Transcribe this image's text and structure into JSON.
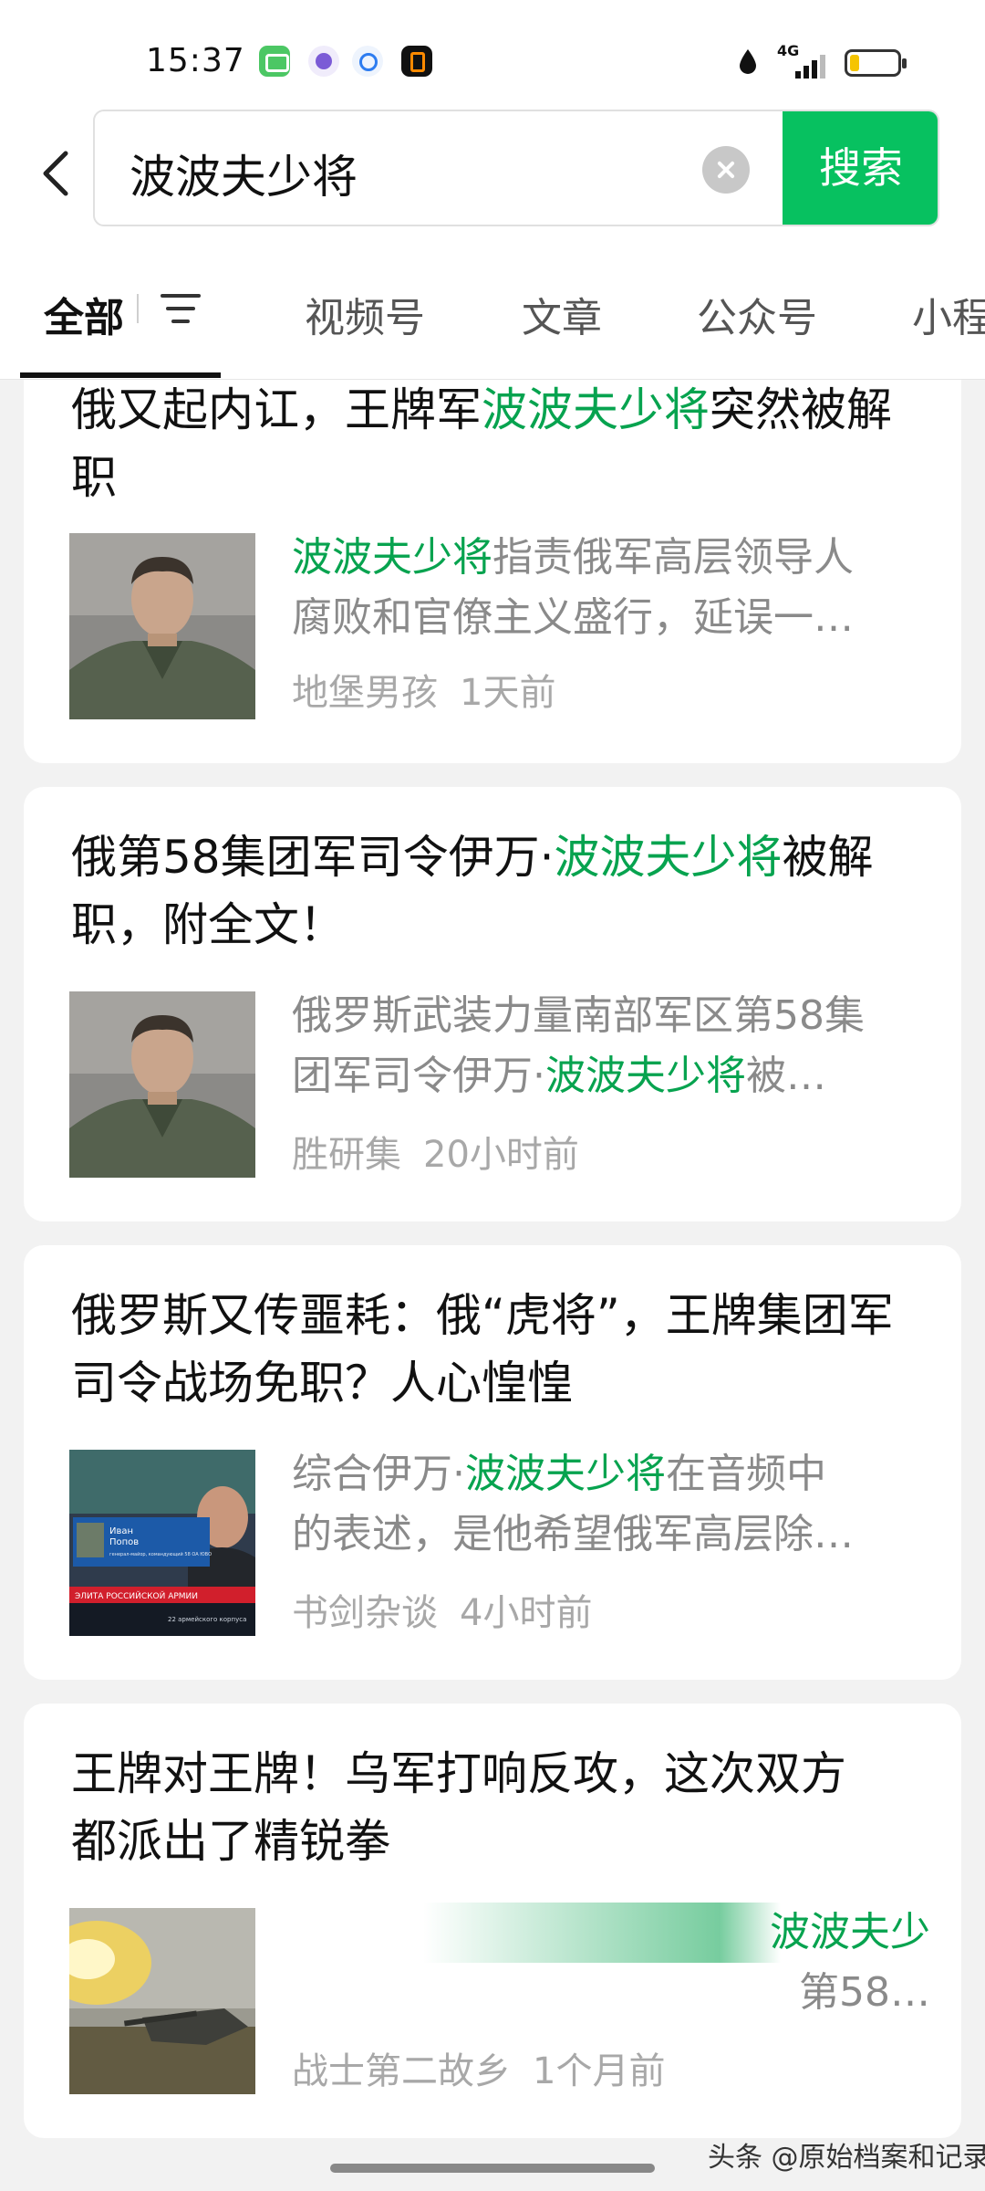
{
  "status_bar": {
    "time": "15:37",
    "network": "4G"
  },
  "search": {
    "query": "波波夫少将",
    "button_label": "搜索"
  },
  "tabs": [
    {
      "label": "全部"
    },
    {
      "label": "视频号"
    },
    {
      "label": "文章"
    },
    {
      "label": "公众号"
    },
    {
      "label": "小程"
    }
  ],
  "results": [
    {
      "title_pre": "俄又起内讧，王牌军",
      "title_hl": "波波夫少将",
      "title_post": "突然被解职",
      "snippet_pre": "",
      "snippet_hl": "波波夫少将",
      "snippet_l1_post": "指责俄军高层领导人",
      "snippet_l2": "腐败和官僚主义盛行，延误一…",
      "source": "地堡男孩",
      "time": "1天前"
    },
    {
      "title_pre": "俄第58集团军司令伊万·",
      "title_hl": "波波夫少将",
      "title_post": "被解职，附全文！",
      "snippet_l1": "俄罗斯武装力量南部军区第58集",
      "snippet_l2_pre": "团军司令伊万·",
      "snippet_hl": "波波夫少将",
      "snippet_l2_post": "被…",
      "source": "胜研集",
      "time": "20小时前"
    },
    {
      "title": "俄罗斯又传噩耗：俄“虎将”，王牌集团军司令战场免职？人心惶惶",
      "snippet_l1_pre": "综合伊万·",
      "snippet_hl": "波波夫少将",
      "snippet_l1_post": "在音频中",
      "snippet_l2": "的表述，是他希望俄军高层除…",
      "source": "书剑杂谈",
      "time": "4小时前",
      "thumb_caption_name": "Иван",
      "thumb_caption_surname": "Попов",
      "thumb_caption_role": "генерал-майор, командующий 58 ОА ЮВО",
      "thumb_ticker": "ЭЛИТА РОССИЙСКОЙ АРМИИ",
      "thumb_ticker_sub": "22 армейского корпуса"
    },
    {
      "title_l1": "王牌对王牌！乌军打响反攻，这次双方",
      "title_l2": "都派出了精锐拳",
      "snippet_l1_hl": "波波夫少",
      "snippet_l2": "第58…",
      "source": "战士第二故乡",
      "time": "1个月前"
    }
  ],
  "watermark": "头条 @原始档案和记录",
  "colors": {
    "accent": "#07c160",
    "highlight": "#07a34f"
  }
}
